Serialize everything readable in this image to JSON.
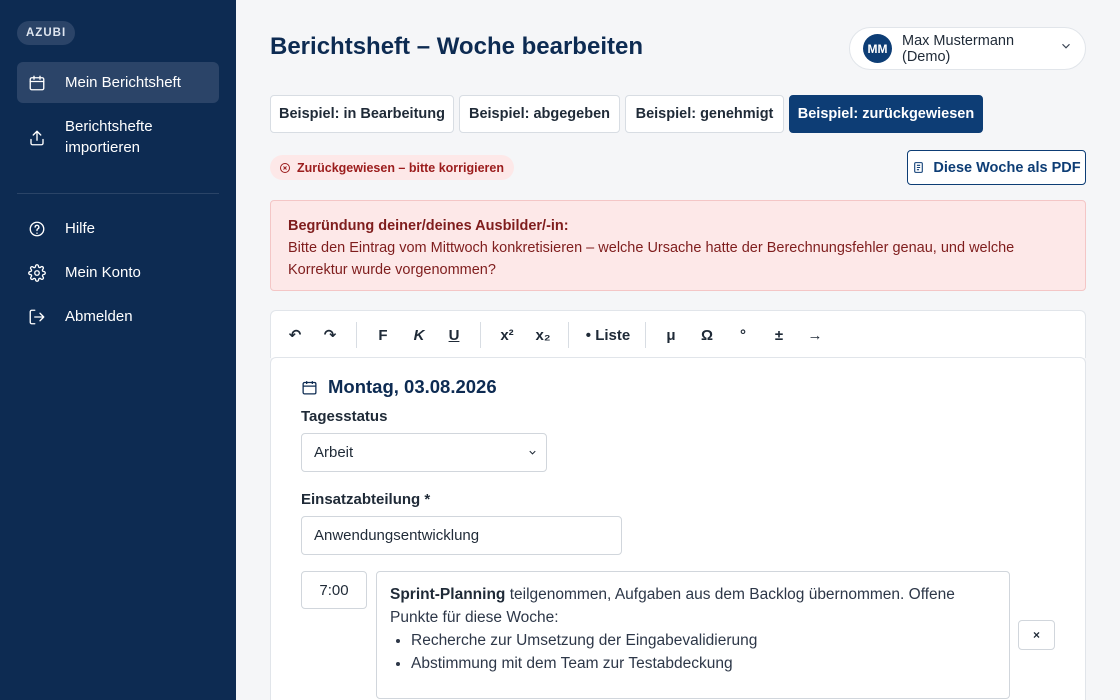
{
  "sidebar": {
    "role_badge": "AZUBI",
    "items": [
      {
        "label": "Mein Berichtsheft",
        "icon": "calendar-icon"
      },
      {
        "label": "Berichtshefte importieren",
        "icon": "upload-icon"
      },
      {
        "label": "Hilfe",
        "icon": "help-icon"
      },
      {
        "label": "Mein Konto",
        "icon": "gear-icon"
      },
      {
        "label": "Abmelden",
        "icon": "logout-icon"
      }
    ]
  },
  "header": {
    "title": "Berichtsheft – Woche bearbeiten",
    "user": {
      "initials": "MM",
      "name": "Max Mustermann (Demo)"
    }
  },
  "tabs": [
    {
      "label": "Beispiel: in Bearbeitung"
    },
    {
      "label": "Beispiel: abgegeben"
    },
    {
      "label": "Beispiel: genehmigt"
    },
    {
      "label": "Beispiel: zurückgewiesen",
      "active": true
    }
  ],
  "status": {
    "label": "Zurückgewiesen – bitte korrigieren"
  },
  "pdf_button": {
    "label": "Diese Woche als PDF"
  },
  "alert": {
    "title": "Begründung deiner/deines Ausbilder/-in:",
    "message": "Bitte den Eintrag vom Mittwoch konkretisieren – welche Ursache hatte der Berechnungsfehler genau, und welche Korrektur wurde vorgenommen?"
  },
  "toolbar": {
    "undo": "↶",
    "redo": "↷",
    "bold": "F",
    "italic": "K",
    "underline": "U",
    "superscript": "x²",
    "subscript": "x₂",
    "list": "• Liste",
    "mu": "μ",
    "omega": "Ω",
    "degree": "°",
    "plusminus": "±",
    "arrow": "→"
  },
  "day": {
    "heading": "Montag, 03.08.2026",
    "status_label": "Tagesstatus",
    "status_value": "Arbeit",
    "department_label": "Einsatzabteilung *",
    "department_value": "Anwendungsentwicklung",
    "entry": {
      "time": "7:00",
      "bold_lead": "Sprint-Planning",
      "text": " teilgenommen, Aufgaben aus dem Backlog übernommen. Offene Punkte für diese Woche:",
      "bullets": [
        "Recherche zur Umsetzung der Eingabevalidierung",
        "Abstimmung mit dem Team zur Testabdeckung"
      ],
      "remove_label": "×"
    }
  },
  "colors": {
    "sidebar": "#0d2b52",
    "primary": "#0d3d75",
    "danger_bg": "#fde8e8",
    "danger_text": "#9b1c1c"
  }
}
